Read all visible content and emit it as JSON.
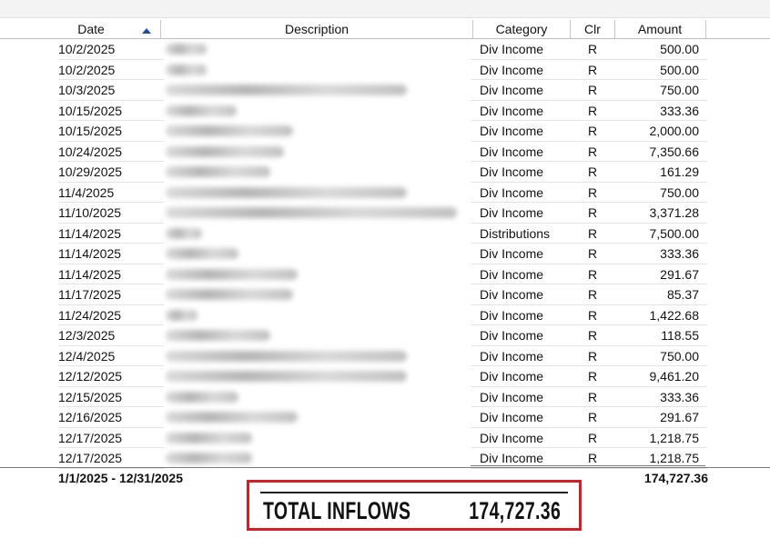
{
  "columns": {
    "date": "Date",
    "description": "Description",
    "category": "Category",
    "clr": "Clr",
    "amount": "Amount"
  },
  "rows": [
    {
      "date": "10/2/2025",
      "category": "Div Income",
      "clr": "R",
      "amount": "500.00"
    },
    {
      "date": "10/2/2025",
      "category": "Div Income",
      "clr": "R",
      "amount": "500.00"
    },
    {
      "date": "10/3/2025",
      "category": "Div Income",
      "clr": "R",
      "amount": "750.00"
    },
    {
      "date": "10/15/2025",
      "category": "Div Income",
      "clr": "R",
      "amount": "333.36"
    },
    {
      "date": "10/15/2025",
      "category": "Div Income",
      "clr": "R",
      "amount": "2,000.00"
    },
    {
      "date": "10/24/2025",
      "category": "Div Income",
      "clr": "R",
      "amount": "7,350.66"
    },
    {
      "date": "10/29/2025",
      "category": "Div Income",
      "clr": "R",
      "amount": "161.29"
    },
    {
      "date": "11/4/2025",
      "category": "Div Income",
      "clr": "R",
      "amount": "750.00"
    },
    {
      "date": "11/10/2025",
      "category": "Div Income",
      "clr": "R",
      "amount": "3,371.28"
    },
    {
      "date": "11/14/2025",
      "category": "Distributions",
      "clr": "R",
      "amount": "7,500.00"
    },
    {
      "date": "11/14/2025",
      "category": "Div Income",
      "clr": "R",
      "amount": "333.36"
    },
    {
      "date": "11/14/2025",
      "category": "Div Income",
      "clr": "R",
      "amount": "291.67"
    },
    {
      "date": "11/17/2025",
      "category": "Div Income",
      "clr": "R",
      "amount": "85.37"
    },
    {
      "date": "11/24/2025",
      "category": "Div Income",
      "clr": "R",
      "amount": "1,422.68"
    },
    {
      "date": "12/3/2025",
      "category": "Div Income",
      "clr": "R",
      "amount": "118.55"
    },
    {
      "date": "12/4/2025",
      "category": "Div Income",
      "clr": "R",
      "amount": "750.00"
    },
    {
      "date": "12/12/2025",
      "category": "Div Income",
      "clr": "R",
      "amount": "9,461.20"
    },
    {
      "date": "12/15/2025",
      "category": "Div Income",
      "clr": "R",
      "amount": "333.36"
    },
    {
      "date": "12/16/2025",
      "category": "Div Income",
      "clr": "R",
      "amount": "291.67"
    },
    {
      "date": "12/17/2025",
      "category": "Div Income",
      "clr": "R",
      "amount": "1,218.75"
    },
    {
      "date": "12/17/2025",
      "category": "Div Income",
      "clr": "R",
      "amount": "1,218.75"
    }
  ],
  "footer": {
    "date_range": "1/1/2025 - 12/31/2025",
    "total": "174,727.36"
  },
  "callout": {
    "label": "TOTAL INFLOWS",
    "value": "174,727.36"
  },
  "colors": {
    "sort_arrow": "#1f4ea3",
    "callout_border": "#d11f26"
  },
  "icons": {
    "sort": "sort-ascending-icon"
  }
}
